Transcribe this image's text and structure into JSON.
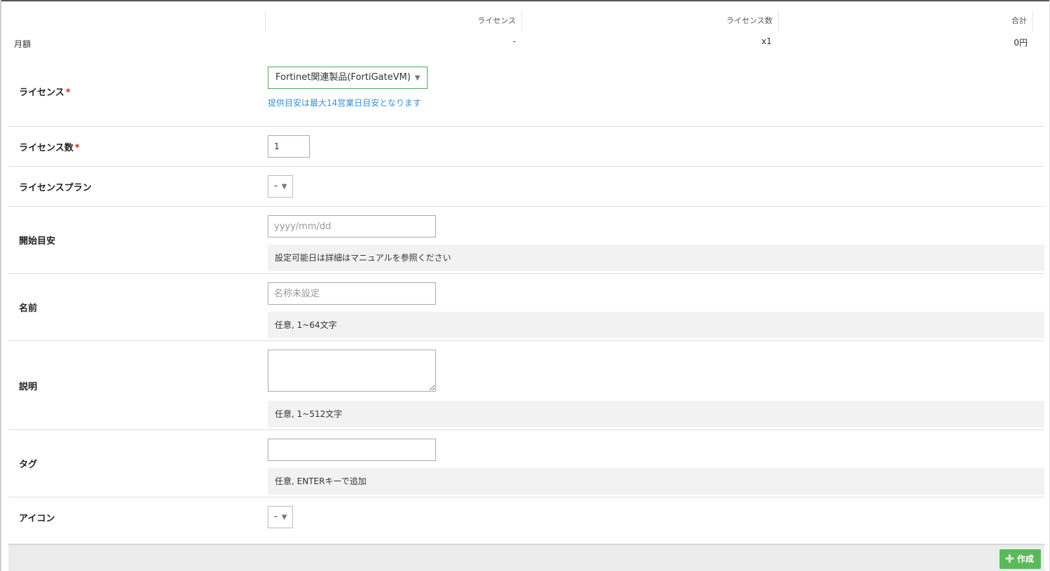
{
  "summary": {
    "headers": [
      "ライセンス",
      "ライセンス数",
      "合計"
    ],
    "row_label": "月額",
    "values": [
      "-",
      "x1",
      "0円"
    ]
  },
  "form": {
    "license": {
      "label": "ライセンス",
      "required_mark": "*",
      "selected": "Fortinet関連製品(FortiGateVM)",
      "note": "提供目安は最大14営業日目安となります"
    },
    "license_count": {
      "label": "ライセンス数",
      "required_mark": "*",
      "value": "1"
    },
    "license_plan": {
      "label": "ライセンスプラン",
      "selected": "-"
    },
    "start_date": {
      "label": "開始目安",
      "placeholder": "yyyy/mm/dd",
      "help": "設定可能日は詳細はマニュアルを参照ください"
    },
    "name": {
      "label": "名前",
      "placeholder": "名称未設定",
      "help": "任意, 1~64文字"
    },
    "description": {
      "label": "説明",
      "help": "任意, 1~512文字"
    },
    "tags": {
      "label": "タグ",
      "help": "任意, ENTERキーで追加"
    },
    "icon": {
      "label": "アイコン",
      "selected": "-"
    }
  },
  "footer": {
    "create_label": "作成"
  },
  "icons": {
    "dropdown": "caret-down-icon",
    "create": "plus-icon"
  },
  "colors": {
    "required": "#d9261c",
    "link": "#3a8fd4",
    "create_button": "#5cb85c",
    "select_active_border": "#4caf50"
  }
}
